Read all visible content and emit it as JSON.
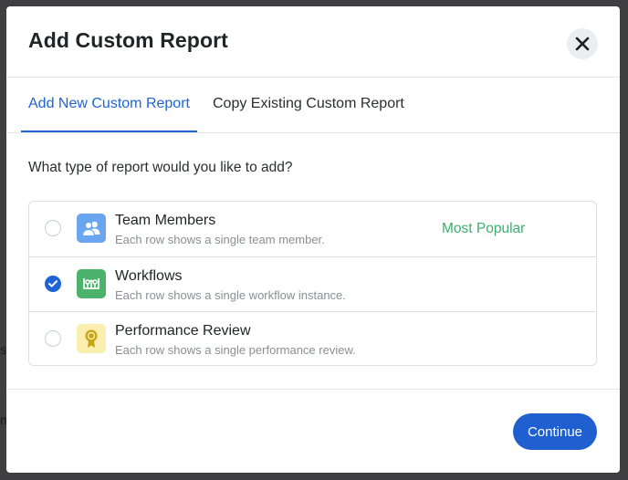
{
  "modal": {
    "title": "Add Custom Report",
    "close_icon": "close-icon"
  },
  "tabs": [
    {
      "label": "Add New Custom Report",
      "active": true
    },
    {
      "label": "Copy Existing Custom Report",
      "active": false
    }
  ],
  "question": "What type of report would you like to add?",
  "options": [
    {
      "title": "Team Members",
      "description": "Each row shows a single team member.",
      "icon": "team-members-icon",
      "selected": false,
      "badge": "Most Popular"
    },
    {
      "title": "Workflows",
      "description": "Each row shows a single workflow instance.",
      "icon": "workflow-icon",
      "selected": true
    },
    {
      "title": "Performance Review",
      "description": "Each row shows a single performance review.",
      "icon": "award-ribbon-icon",
      "selected": false
    }
  ],
  "footer": {
    "continue_label": "Continue"
  },
  "backdrop": {
    "fragment_1": "s",
    "fragment_2": "n"
  },
  "colors": {
    "accent": "#1f63d6",
    "badge_green": "#3bb06a",
    "team_icon_bg": "#6aa5f0",
    "workflow_icon_bg": "#4cb36c",
    "review_icon_bg": "#fbefb0",
    "review_icon_fg": "#c8a415",
    "backdrop": "#3f3f41"
  }
}
